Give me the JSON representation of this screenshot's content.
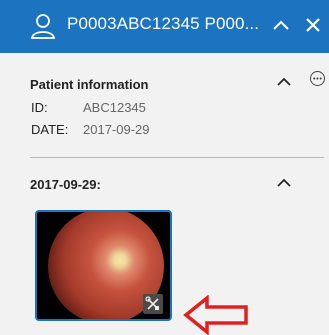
{
  "header": {
    "title": "P0003ABC12345 P000...",
    "icons": [
      "user-icon",
      "chevron-up-icon",
      "close-icon"
    ]
  },
  "patient_info": {
    "heading": "Patient information",
    "rows": [
      {
        "label": "ID:",
        "value": "ABC12345"
      },
      {
        "label": "DATE:",
        "value": "2017-09-29"
      }
    ]
  },
  "study": {
    "heading": "2017-09-29:",
    "thumbnail": "retina-fundus-image",
    "badge_icon": "tools-icon"
  },
  "annotation": {
    "icon": "arrow-left-icon",
    "color": "#e02020"
  },
  "colors": {
    "header_bg": "#1c73bf",
    "thumbnail_border": "#1c73bf"
  }
}
